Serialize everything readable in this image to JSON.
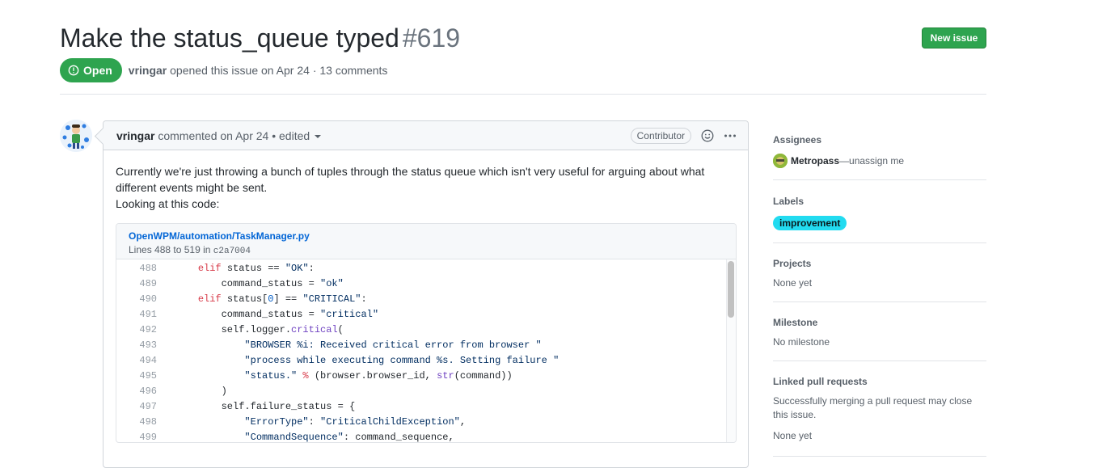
{
  "issue": {
    "title": "Make the status_queue typed",
    "number": "#619",
    "state": "Open",
    "author": "vringar",
    "opened_text": "opened this issue on Apr 24 · 13 comments"
  },
  "header": {
    "new_issue_label": "New issue"
  },
  "comment": {
    "author": "vringar",
    "action_text": "commented on Apr 24 • edited",
    "badge": "Contributor",
    "body_line1": "Currently we're just throwing a bunch of tuples through the status queue which isn't very useful for arguing about what",
    "body_line2": "different events might be sent.",
    "body_line3": "Looking at this code:"
  },
  "snippet": {
    "file_path": "OpenWPM/automation/TaskManager.py",
    "lines_text": "Lines 488 to 519 in",
    "commit": "c2a7004",
    "line_numbers": [
      "488",
      "489",
      "490",
      "491",
      "492",
      "493",
      "494",
      "495",
      "496",
      "497",
      "498",
      "499"
    ],
    "code": {
      "l488_kw": "elif",
      "l488_rest": " status == ",
      "l488_str": "\"OK\"",
      "l488_end": ":",
      "l489_a": "        command_status = ",
      "l489_str": "\"ok\"",
      "l490_kw": "elif",
      "l490_a": " status[",
      "l490_num": "0",
      "l490_b": "] == ",
      "l490_str": "\"CRITICAL\"",
      "l490_end": ":",
      "l491_a": "        command_status = ",
      "l491_str": "\"critical\"",
      "l492_a": "        self.logger.",
      "l492_fn": "critical",
      "l492_end": "(",
      "l493_str": "            \"BROWSER %i: Received critical error from browser \"",
      "l494_str": "            \"process while executing command %s. Setting failure \"",
      "l495_str": "            \"status.\"",
      "l495_kw": " %",
      "l495_a": " (browser.browser_id, ",
      "l495_fn": "str",
      "l495_end": "(command))",
      "l496_a": "        )",
      "l497_a": "        self.failure_status = {",
      "l498_str": "            \"ErrorType\"",
      "l498_a": ": ",
      "l498_str2": "\"CriticalChildException\"",
      "l498_end": ",",
      "l499_str": "            \"CommandSequence\"",
      "l499_a": ": command_sequence,"
    }
  },
  "sidebar": {
    "assignees_title": "Assignees",
    "assignee_name": "Metropass",
    "assignee_action": " —unassign me",
    "labels_title": "Labels",
    "label": "improvement",
    "label_color": "#22dbf0",
    "projects_title": "Projects",
    "projects_value": "None yet",
    "milestone_title": "Milestone",
    "milestone_value": "No milestone",
    "linked_title": "Linked pull requests",
    "linked_text": "Successfully merging a pull request may close this issue.",
    "linked_value": "None yet"
  },
  "colors": {
    "open_green": "#2ea44f",
    "link_blue": "#0366d6"
  }
}
